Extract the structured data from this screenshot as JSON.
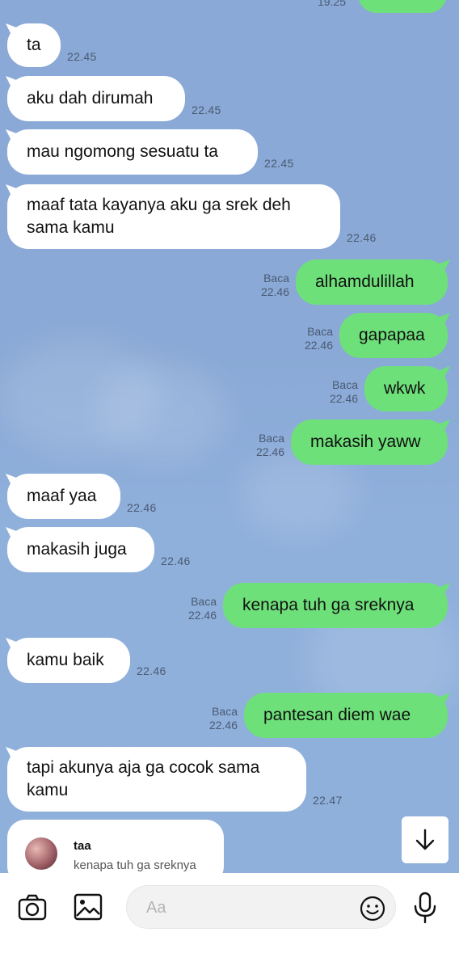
{
  "top_partial": {
    "time": "19.25"
  },
  "messages": [
    {
      "dir": "in",
      "text": "ta",
      "time": "22.45"
    },
    {
      "dir": "in",
      "text": "aku dah dirumah",
      "time": "22.45"
    },
    {
      "dir": "in",
      "text": "mau ngomong sesuatu ta",
      "time": "22.45"
    },
    {
      "dir": "in",
      "text": "maaf tata kayanya aku ga srek deh sama kamu",
      "time": "22.46"
    },
    {
      "dir": "out",
      "text": "alhamdulillah",
      "read": "Baca",
      "time": "22.46"
    },
    {
      "dir": "out",
      "text": "gapapaa",
      "read": "Baca",
      "time": "22.46"
    },
    {
      "dir": "out",
      "text": "wkwk",
      "read": "Baca",
      "time": "22.46"
    },
    {
      "dir": "out",
      "text": "makasih yaww",
      "read": "Baca",
      "time": "22.46"
    },
    {
      "dir": "in",
      "text": "maaf yaa",
      "time": "22.46"
    },
    {
      "dir": "in",
      "text": "makasih juga",
      "time": "22.46"
    },
    {
      "dir": "out",
      "text": "kenapa tuh ga sreknya",
      "read": "Baca",
      "time": "22.46"
    },
    {
      "dir": "in",
      "text": "kamu baik",
      "time": "22.46"
    },
    {
      "dir": "out",
      "text": "pantesan diem wae",
      "read": "Baca",
      "time": "22.46"
    },
    {
      "dir": "in",
      "text": "tapi akunya aja ga cocok sama kamu",
      "time": "22.47"
    }
  ],
  "reply_preview": {
    "name": "taa",
    "text": "kenapa tuh ga sreknya"
  },
  "composer": {
    "placeholder": "Aa"
  },
  "icons": {
    "camera": "camera-icon",
    "image": "image-icon",
    "emoji": "emoji-icon",
    "mic": "microphone-icon",
    "scroll_down": "arrow-down-icon"
  },
  "colors": {
    "incoming": "#ffffff",
    "outgoing": "#6ee07a",
    "background": "#8aa9d6"
  }
}
